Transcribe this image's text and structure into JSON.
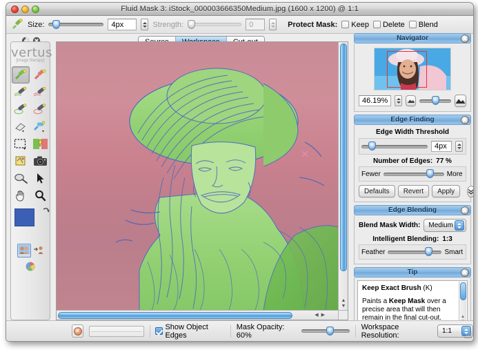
{
  "window": {
    "title": "Fluid Mask 3: iStock_000003666350Medium.jpg (1600 x 1200) @ 1:1",
    "close_label": "",
    "minimize_label": "",
    "zoom_label": ""
  },
  "toolbar": {
    "brush_icon": "brush-icon",
    "size_label": "Size:",
    "size_value": "4px",
    "strength_label": "Strength:",
    "strength_value": "0",
    "protect_mask_label": "Protect Mask:",
    "protect_options": [
      {
        "label": "Keep",
        "checked": false
      },
      {
        "label": "Delete",
        "checked": false
      },
      {
        "label": "Blend",
        "checked": false
      }
    ]
  },
  "tabs": [
    {
      "label": "Source",
      "active": false
    },
    {
      "label": "Workspace",
      "active": true
    },
    {
      "label": "Cut-out",
      "active": false
    }
  ],
  "palette": {
    "brand_name": "vertus",
    "brand_tagline": "[image therapy]",
    "tools": [
      {
        "name": "keep-exact-brush",
        "selected": true
      },
      {
        "name": "delete-exact-brush",
        "selected": false
      },
      {
        "name": "keep-local-brush",
        "selected": false
      },
      {
        "name": "delete-local-brush",
        "selected": false
      },
      {
        "name": "keep-complex-brush",
        "selected": false
      },
      {
        "name": "delete-complex-brush",
        "selected": false
      },
      {
        "name": "eraser-tool",
        "selected": false
      },
      {
        "name": "blend-exact-brush",
        "selected": false
      },
      {
        "name": "marquee-tool",
        "selected": false
      },
      {
        "name": "fill-tool",
        "selected": false
      },
      {
        "name": "patch-tool",
        "selected": false
      },
      {
        "name": "snapshot-tool",
        "selected": false
      },
      {
        "name": "magic-wand-tool",
        "selected": false
      },
      {
        "name": "arrow-tool",
        "selected": false
      },
      {
        "name": "hand-tool",
        "selected": false
      },
      {
        "name": "zoom-tool",
        "selected": false
      }
    ],
    "foreground_color": "#3c5fb6",
    "background_color": "transparent-checkerboard",
    "blend_preview_selected": true
  },
  "navigator": {
    "title": "Navigator",
    "zoom_value": "46.19%",
    "zoom_out_icon": "small-mountain-icon",
    "zoom_in_icon": "large-mountain-icon"
  },
  "edge_finding": {
    "title": "Edge Finding",
    "threshold_label": "Edge Width Threshold",
    "threshold_value": "4px",
    "edges_label": "Number of Edges:",
    "edges_value": "77 %",
    "fewer_label": "Fewer",
    "more_label": "More",
    "buttons": [
      "Defaults",
      "Revert",
      "Apply"
    ],
    "expand_icon": "double-chevron-down-icon"
  },
  "edge_blending": {
    "title": "Edge Blending",
    "blend_width_label": "Blend Mask Width:",
    "blend_width_value": "Medium",
    "intelligent_label": "Intelligent Blending:",
    "intelligent_value": "1:3",
    "feather_label": "Feather",
    "smart_label": "Smart"
  },
  "tip": {
    "title": "Tip",
    "heading": "Keep Exact Brush",
    "shortcut": "(K)",
    "body_pre": "Paints a ",
    "body_bold": "Keep Mask",
    "body_post": " over a precise area that will then remain in the final cut-out."
  },
  "statusbar": {
    "stop_icon": "stop-icon",
    "show_object_edges_label": "Show Object Edges",
    "show_object_edges_checked": true,
    "mask_opacity_label": "Mask Opacity: 60%",
    "workspace_resolution_label": "Workspace Resolution:",
    "workspace_resolution_value": "1:1"
  }
}
